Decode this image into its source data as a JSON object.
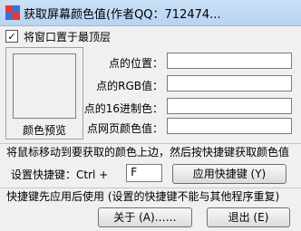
{
  "window": {
    "title": "获取屏幕颜色值(作者QQ：712474..."
  },
  "options": {
    "topmost_label": "将窗口置于最顶层",
    "topmost_checked_mark": "✓"
  },
  "preview": {
    "label": "颜色预览"
  },
  "info": {
    "position_label": "点的位置：",
    "rgb_label": "点的RGB值：",
    "hex_label": "点的16进制色：",
    "web_label": "点网页颜色值：",
    "position_value": "",
    "rgb_value": "",
    "hex_value": "",
    "web_value": ""
  },
  "instructions": {
    "text": "将鼠标移动到要获取的颜色上边，然后按快捷键获取颜色值"
  },
  "hotkey": {
    "label": "设置快捷键：Ctrl  +",
    "value": "F",
    "apply_button": "应用快捷键 (Y)"
  },
  "note": {
    "text": "快捷键先应用后使用 (设置的快捷键不能与其他程序重复)"
  },
  "buttons": {
    "about": "关于 (A)……",
    "exit": "退出 (E)"
  }
}
